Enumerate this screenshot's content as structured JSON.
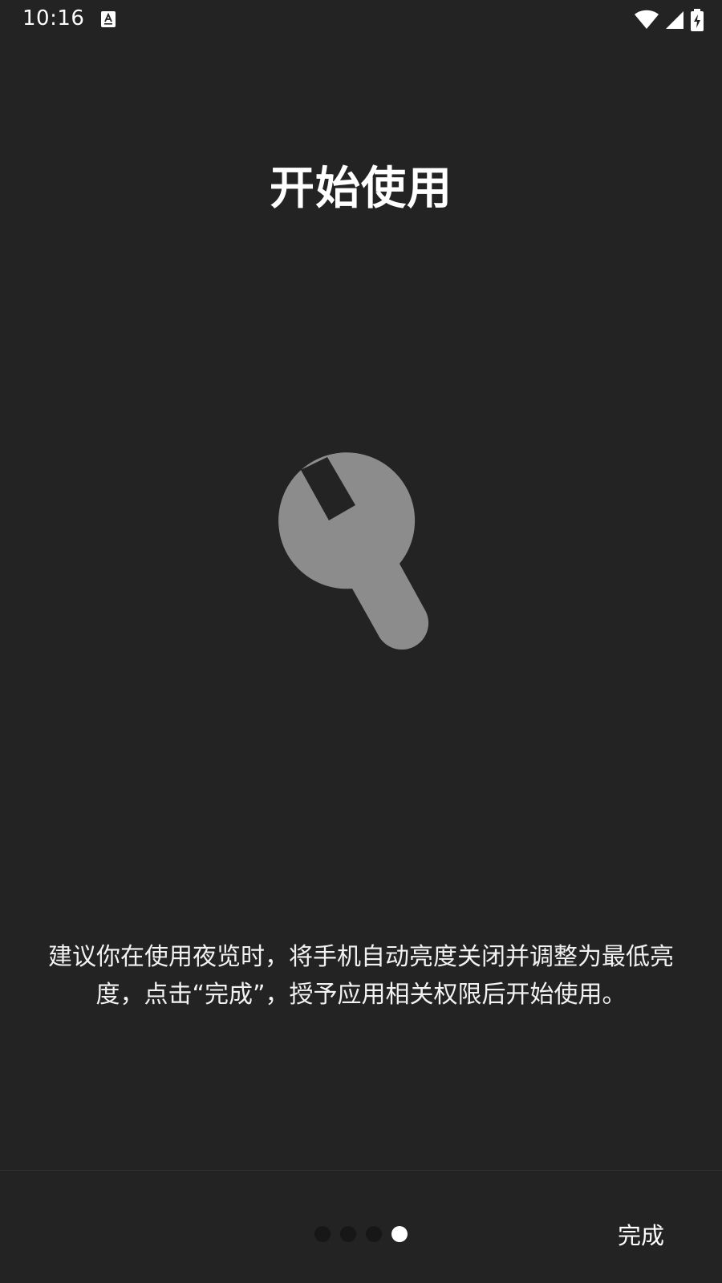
{
  "status_bar": {
    "time": "10:16",
    "notification_icon": "app-notification-icon",
    "icons": [
      "wifi-icon",
      "cellular-signal-icon",
      "battery-charging-icon"
    ]
  },
  "page": {
    "title": "开始使用",
    "hero_icon": "wrench-icon",
    "description_lines": [
      "建议你在使用夜览时，将手机自动亮度关闭并调整为最低亮",
      "度，点击“完成”，授予应用相关权限后开始使用。"
    ]
  },
  "pager": {
    "total": 4,
    "current": 4
  },
  "bottom_bar": {
    "done_label": "完成"
  },
  "colors": {
    "background": "#232323",
    "icon_gray": "#8c8c8c",
    "dot_inactive": "#171717",
    "dot_active": "#ffffff",
    "text": "#ffffff"
  }
}
